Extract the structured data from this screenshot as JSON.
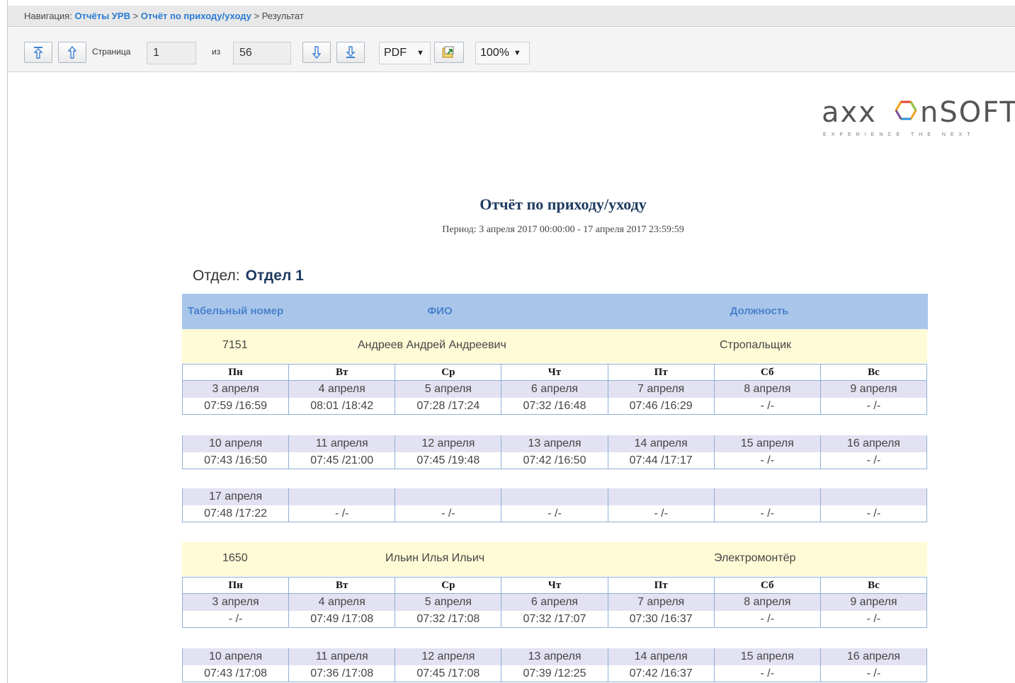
{
  "nav": {
    "prefix": "Навигация:",
    "crumb1": "Отчёты УРВ",
    "crumb2": "Отчёт по приходу/уходу",
    "separator": ">",
    "current": "Результат"
  },
  "toolbar": {
    "page_label": "Страница",
    "page_value": "1",
    "of_label": "из",
    "total_pages": "56",
    "format": "PDF",
    "zoom": "100%"
  },
  "logo": {
    "text": "axxonsoft",
    "tagline": "EXPERIENCE THE NEXT"
  },
  "report": {
    "title": "Отчёт по приходу/уходу",
    "period": "Период: 3 апреля 2017 00:00:00 - 17 апреля 2017 23:59:59",
    "dept_label": "Отдел:",
    "dept_name": "Отдел 1",
    "headers": {
      "tab": "Табельный номер",
      "fio": "ФИО",
      "position": "Должность"
    },
    "weekdays": [
      "Пн",
      "Вт",
      "Ср",
      "Чт",
      "Пт",
      "Сб",
      "Вс"
    ],
    "employees": [
      {
        "tab": "7151",
        "name": "Андреев Андрей Андреевич",
        "position": "Стропальщик",
        "weeks": [
          {
            "dates": [
              "3 апреля",
              "4 апреля",
              "5 апреля",
              "6 апреля",
              "7 апреля",
              "8 апреля",
              "9 апреля"
            ],
            "times": [
              "07:59 /16:59",
              "08:01 /18:42",
              "07:28 /17:24",
              "07:32 /16:48",
              "07:46 /16:29",
              "- /-",
              "- /-"
            ]
          },
          {
            "dates": [
              "10 апреля",
              "11 апреля",
              "12 апреля",
              "13 апреля",
              "14 апреля",
              "15 апреля",
              "16 апреля"
            ],
            "times": [
              "07:43 /16:50",
              "07:45 /21:00",
              "07:45 /19:48",
              "07:42 /16:50",
              "07:44 /17:17",
              "- /-",
              "- /-"
            ]
          },
          {
            "dates": [
              "17 апреля",
              "",
              "",
              "",
              "",
              "",
              ""
            ],
            "times": [
              "07:48 /17:22",
              "- /-",
              "- /-",
              "- /-",
              "- /-",
              "- /-",
              "- /-"
            ]
          }
        ]
      },
      {
        "tab": "1650",
        "name": "Ильин Илья Ильич",
        "position": "Электромонтёр",
        "weeks": [
          {
            "dates": [
              "3 апреля",
              "4 апреля",
              "5 апреля",
              "6 апреля",
              "7 апреля",
              "8 апреля",
              "9 апреля"
            ],
            "times": [
              "- /-",
              "07:49 /17:08",
              "07:32 /17:08",
              "07:32 /17:07",
              "07:30 /16:37",
              "- /-",
              "- /-"
            ]
          },
          {
            "dates": [
              "10 апреля",
              "11 апреля",
              "12 апреля",
              "13 апреля",
              "14 апреля",
              "15 апреля",
              "16 апреля"
            ],
            "times": [
              "07:43 /17:08",
              "07:36 /17:08",
              "07:45 /17:08",
              "07:39 /12:25",
              "07:42 /16:37",
              "- /-",
              "- /-"
            ]
          }
        ]
      }
    ]
  }
}
